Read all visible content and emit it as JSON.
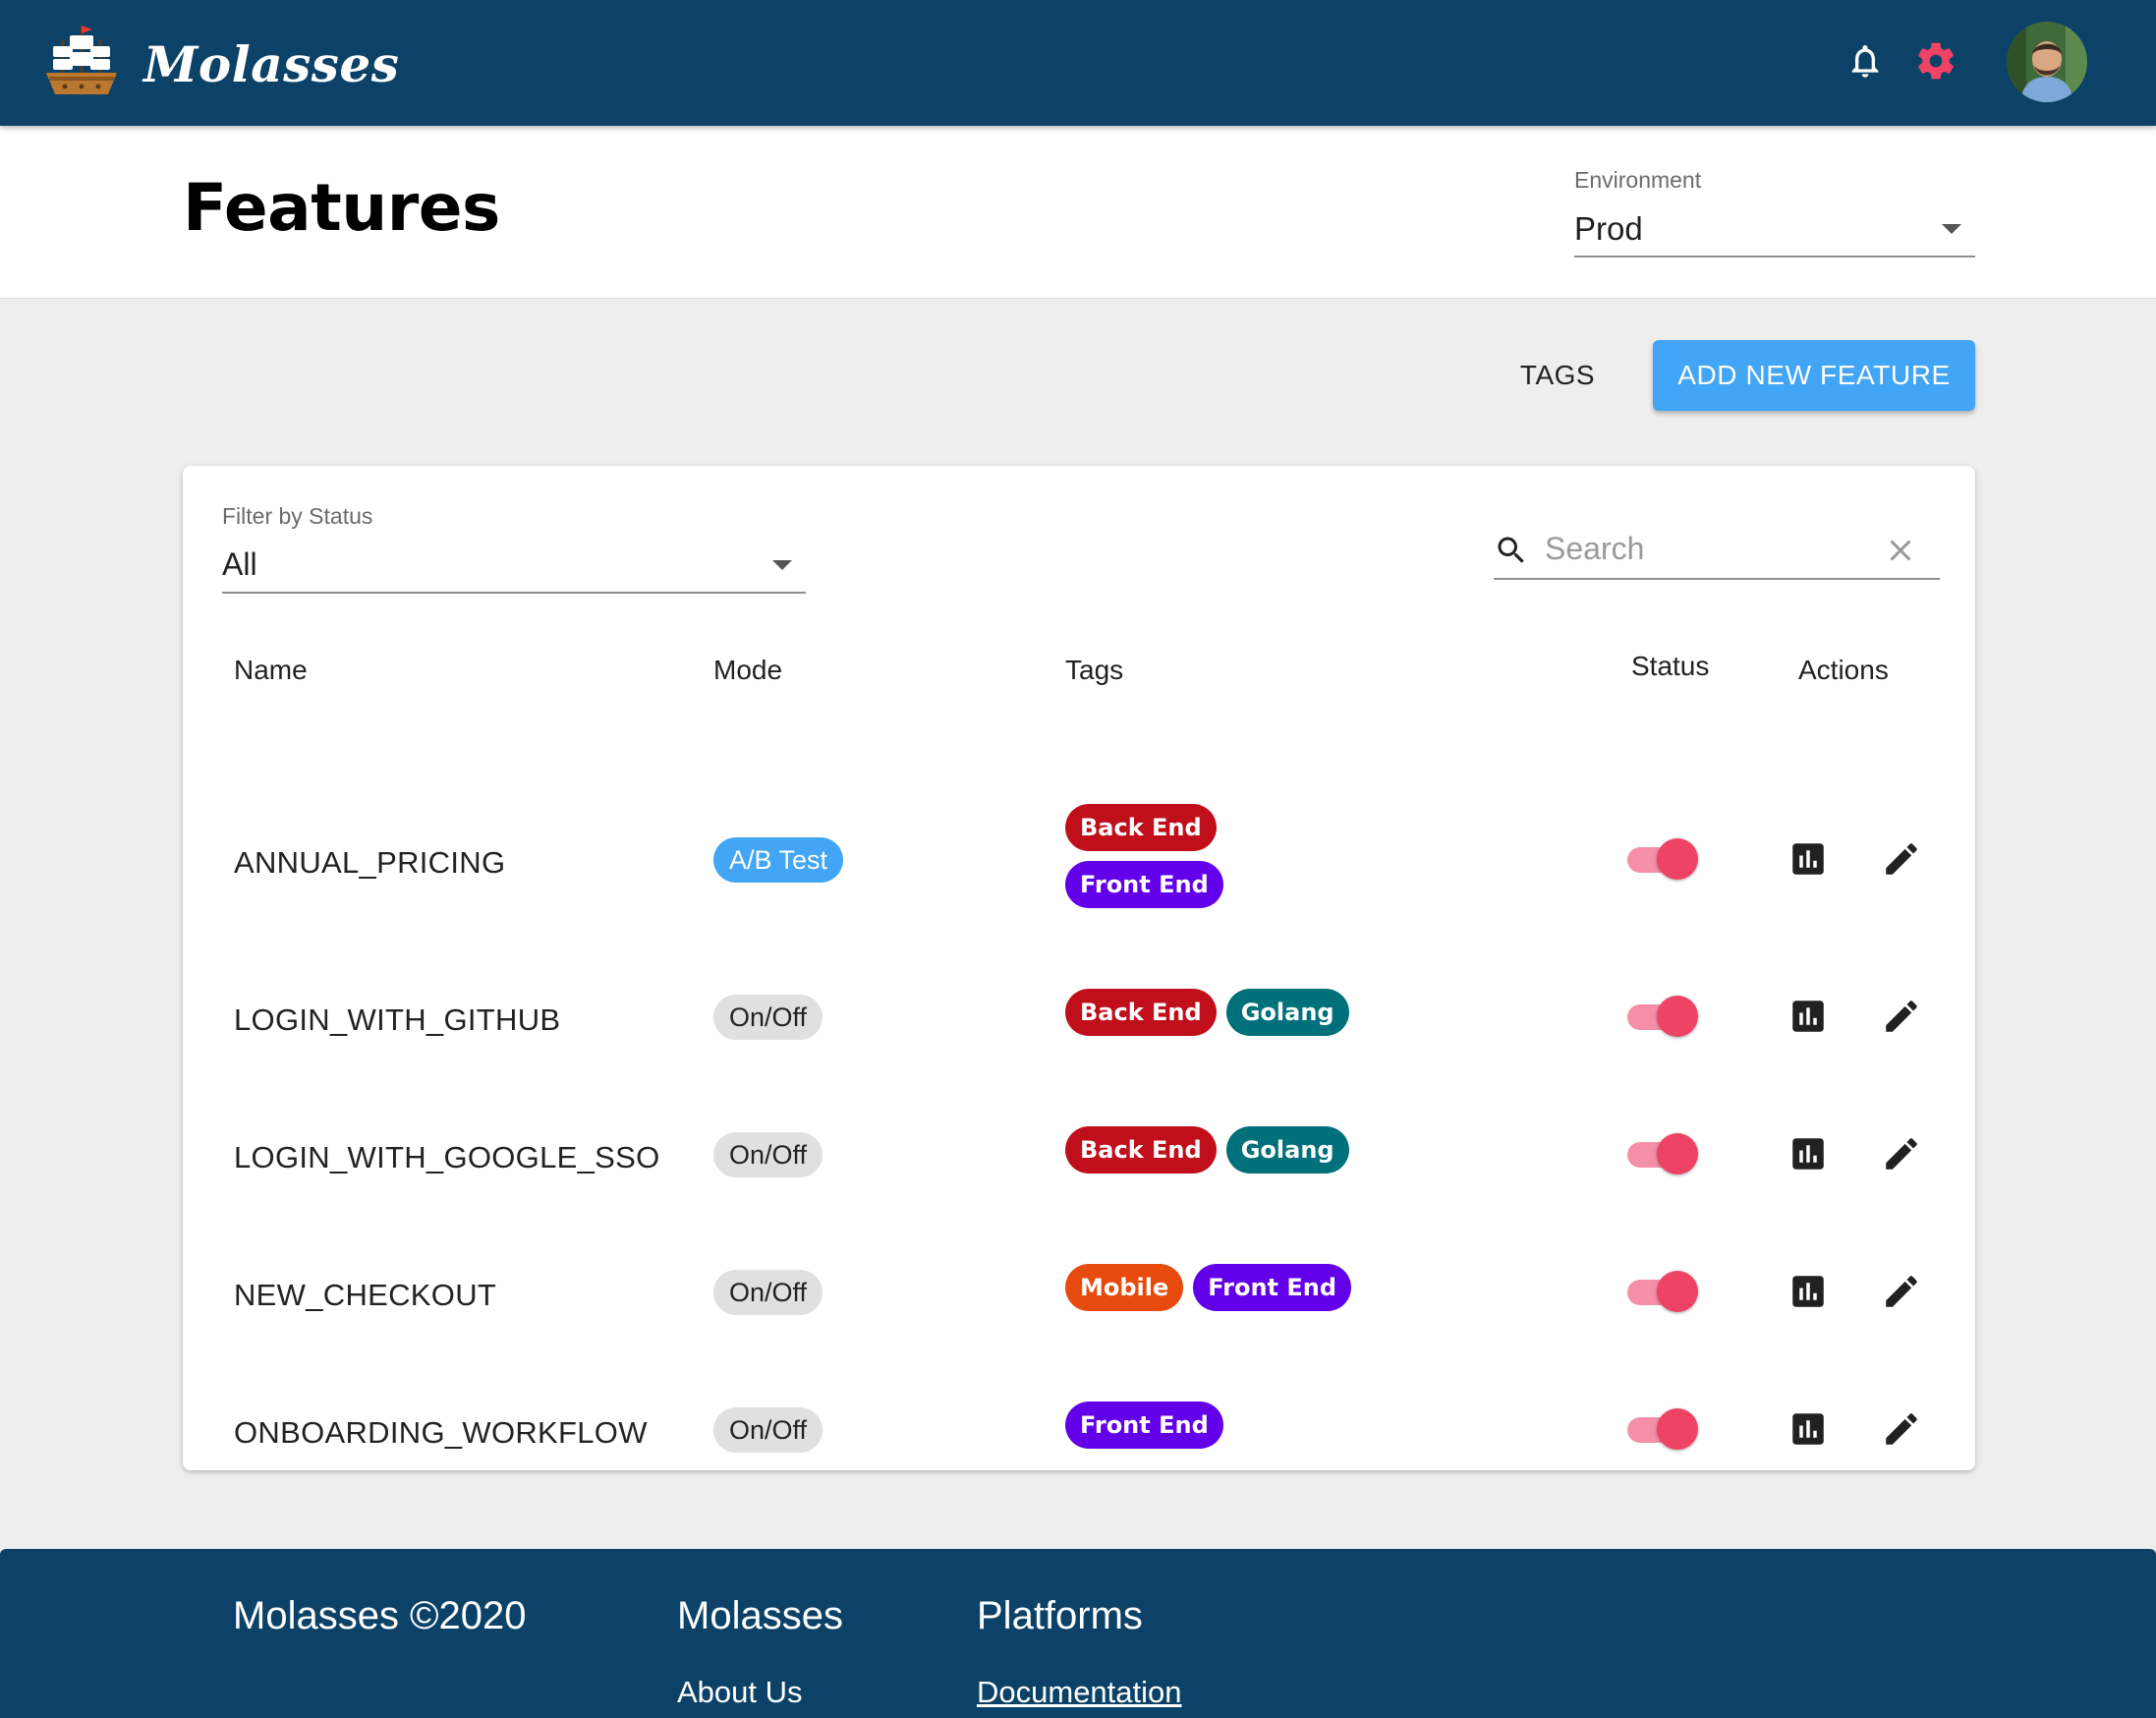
{
  "app": {
    "name": "Molasses"
  },
  "header": {
    "icons": [
      "ship-logo-icon",
      "bell-icon",
      "gear-icon",
      "avatar"
    ],
    "accent_color": "#0c4268",
    "gear_color": "#ef4366"
  },
  "page": {
    "title": "Features",
    "environment": {
      "label": "Environment",
      "value": "Prod"
    }
  },
  "actions": {
    "tags_label": "TAGS",
    "add_label": "ADD NEW FEATURE"
  },
  "filter": {
    "label": "Filter by Status",
    "value": "All"
  },
  "search": {
    "placeholder": "Search",
    "value": ""
  },
  "table": {
    "columns": [
      "Name",
      "Mode",
      "Tags",
      "Status",
      "Actions"
    ],
    "rows": [
      {
        "name": "ANNUAL_PRICING",
        "mode": "A/B Test",
        "tags": [
          "Back End",
          "Front End"
        ],
        "enabled": true
      },
      {
        "name": "LOGIN_WITH_GITHUB",
        "mode": "On/Off",
        "tags": [
          "Back End",
          "Golang"
        ],
        "enabled": true
      },
      {
        "name": "LOGIN_WITH_GOOGLE_SSO",
        "mode": "On/Off",
        "tags": [
          "Back End",
          "Golang"
        ],
        "enabled": true
      },
      {
        "name": "NEW_CHECKOUT",
        "mode": "On/Off",
        "tags": [
          "Mobile",
          "Front End"
        ],
        "enabled": true
      },
      {
        "name": "ONBOARDING_WORKFLOW",
        "mode": "On/Off",
        "tags": [
          "Front End"
        ],
        "enabled": true
      }
    ],
    "tag_colors": {
      "Back End": "#c00f1b",
      "Front End": "#6200ea",
      "Golang": "#00707a",
      "Mobile": "#e64a0c"
    },
    "mode_colors": {
      "A/B Test": "#42a5f5",
      "On/Off": "#e0e0e0"
    },
    "toggle_color": "#ef4366",
    "action_icons": [
      "bar-chart-icon",
      "pencil-icon"
    ]
  },
  "footer": {
    "copyright": "Molasses ©2020",
    "col1_title": "Molasses",
    "col1_link": "About Us",
    "col2_title": "Platforms",
    "col2_link": "Documentation"
  }
}
